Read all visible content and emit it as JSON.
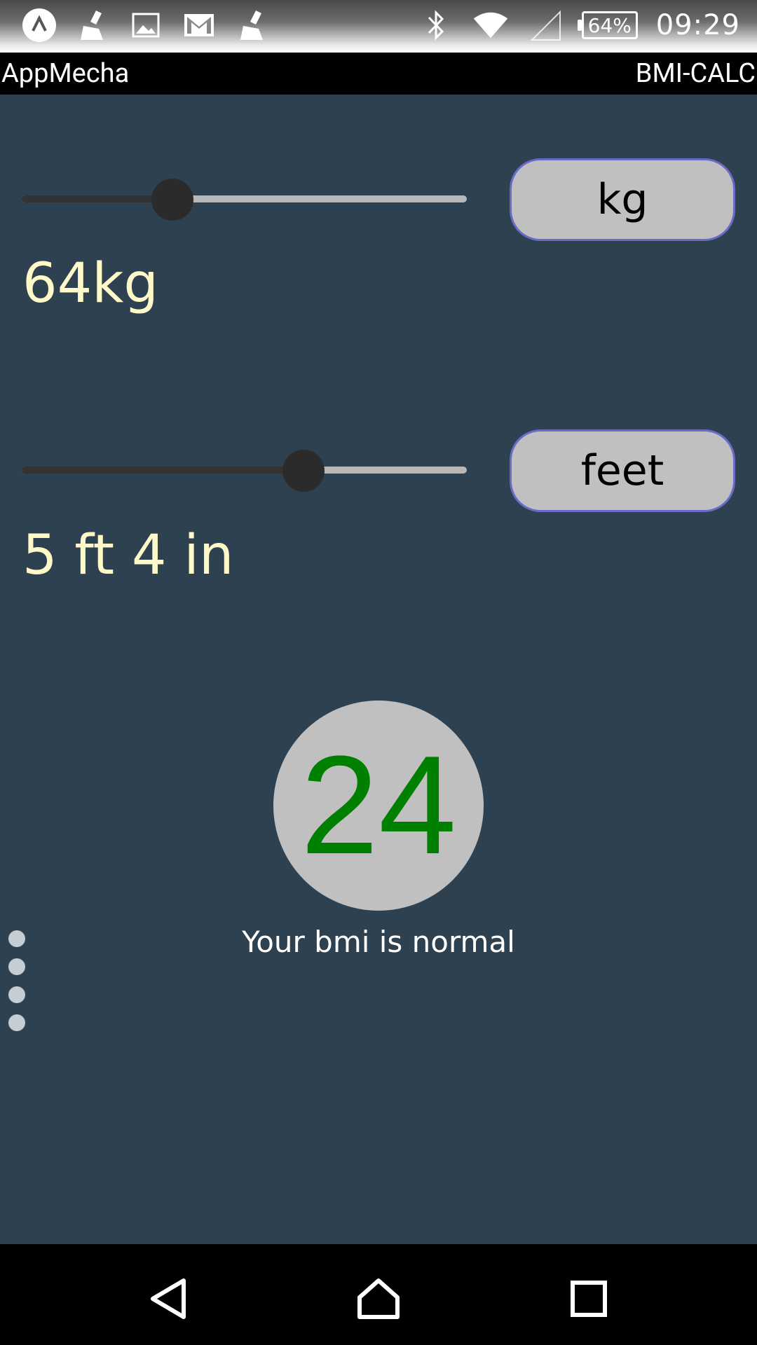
{
  "status_bar": {
    "left_icons": [
      "app-icon",
      "broom-icon",
      "image-icon",
      "gmail-icon",
      "broom-icon"
    ],
    "right_icons": [
      "bluetooth-icon",
      "wifi-icon",
      "signal-icon"
    ],
    "battery": "64%",
    "time": "09:29"
  },
  "title_bar": {
    "app_name": "AppMecha",
    "screen_title": "BMI-CALC"
  },
  "weight": {
    "slider_level": 0.34,
    "unit_button": "kg",
    "value_label": "64kg"
  },
  "height": {
    "slider_level": 0.634,
    "unit_button": "feet",
    "value_label": "5 ft 4 in"
  },
  "result": {
    "bmi_value": "24",
    "bmi_color": "#008000",
    "message": "Your bmi is normal"
  },
  "nav_bar": {
    "buttons": [
      "back-icon",
      "home-icon",
      "recents-icon"
    ]
  }
}
